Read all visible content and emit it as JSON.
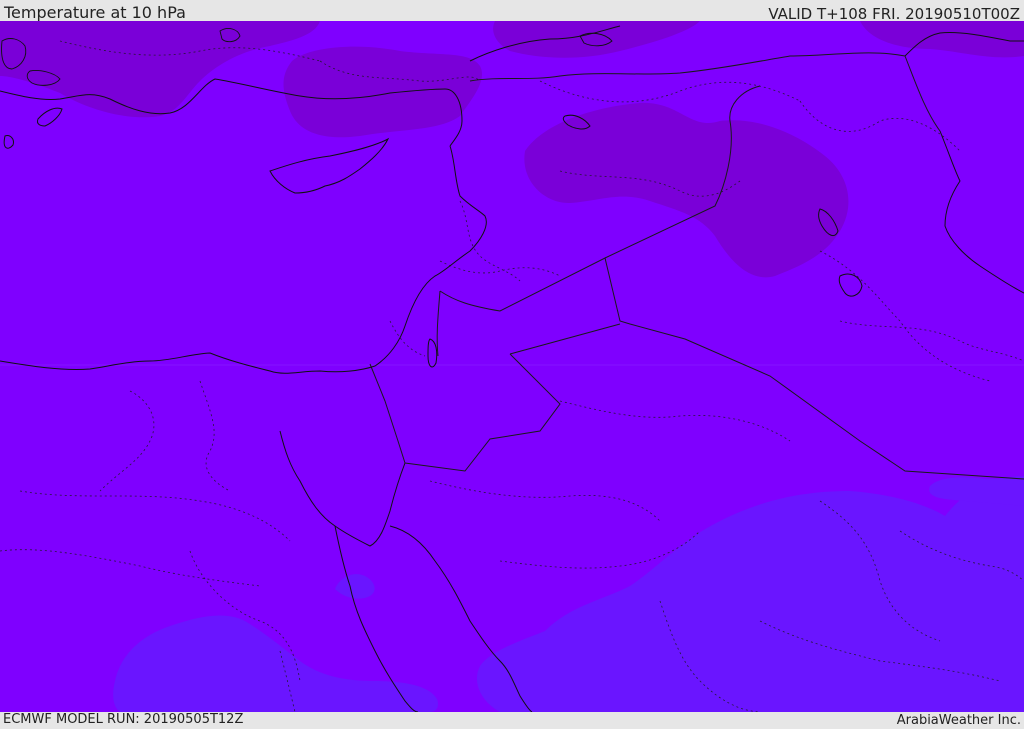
{
  "header": {
    "title": "Temperature at 10 hPa",
    "valid": "VALID T+108 FRI. 20190510T00Z"
  },
  "footer": {
    "model_run": "ECMWF MODEL RUN: 20190505T12Z",
    "brand": "ArabiaWeather Inc."
  },
  "map": {
    "fill_colors": {
      "base": "#7f00ff",
      "cold_patch": "#7a00d6",
      "warm_patch": "#6a15ff",
      "coastline": "#111111",
      "border": "#222222"
    }
  }
}
